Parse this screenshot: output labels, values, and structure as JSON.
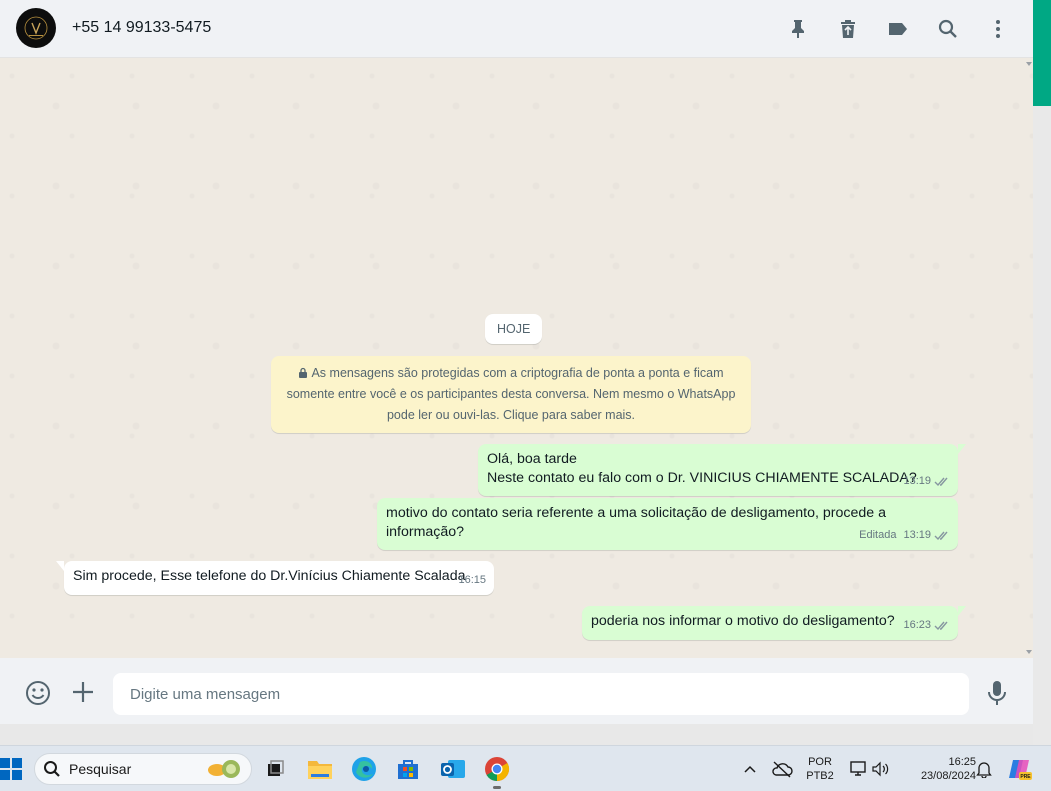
{
  "header": {
    "contact_name": "+55 14 99133-5475",
    "icons": [
      "pin-icon",
      "trash-icon",
      "label-icon",
      "search-icon",
      "menu-icon"
    ]
  },
  "chat": {
    "date_chip": "HOJE",
    "encryption_notice": "As mensagens são protegidas com a criptografia de ponta a ponta e ficam somente entre você e os participantes desta conversa. Nem mesmo o WhatsApp pode ler ou ouvi-las. Clique para saber mais.",
    "messages": [
      {
        "direction": "out",
        "line1": "Olá, boa tarde",
        "line2": "Neste contato eu falo com o Dr. VINICIUS CHIAMENTE SCALADA?",
        "time": "13:19",
        "status": "read"
      },
      {
        "direction": "out",
        "text": "motivo do contato seria referente a uma solicitação de desligamento, procede a informação?",
        "edited": "Editada",
        "time": "13:19",
        "status": "read"
      },
      {
        "direction": "in",
        "text": "Sim procede, Esse telefone do Dr.Vinícius Chiamente Scalada",
        "time": "16:15"
      },
      {
        "direction": "out",
        "text": "poderia nos informar o motivo do desligamento?",
        "time": "16:23",
        "status": "read"
      }
    ]
  },
  "composer": {
    "placeholder": "Digite uma mensagem"
  },
  "taskbar": {
    "search_label": "Pesquisar",
    "lang_line1": "POR",
    "lang_line2": "PTB2",
    "time": "16:25",
    "date": "23/08/2024",
    "copilot_badge": "PRE"
  },
  "colors": {
    "outgoing_bubble": "#d9fdd3",
    "incoming_bubble": "#ffffff",
    "system_notice": "#fcf4cb",
    "accent": "#00a884",
    "read_ticks": "#8696a0"
  }
}
